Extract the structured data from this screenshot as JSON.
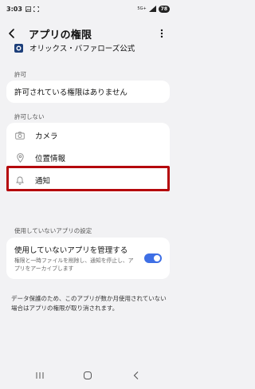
{
  "status": {
    "time": "3:03",
    "signal_label": "5G+",
    "battery": "78"
  },
  "header": {
    "title": "アプリの権限"
  },
  "app": {
    "name": "オリックス・バファローズ公式"
  },
  "allowed": {
    "label": "許可",
    "empty_text": "許可されている権限はありません"
  },
  "denied": {
    "label": "許可しない",
    "items": [
      {
        "label": "カメラ",
        "icon": "camera-icon"
      },
      {
        "label": "位置情報",
        "icon": "location-icon"
      },
      {
        "label": "通知",
        "icon": "bell-icon"
      }
    ]
  },
  "unused": {
    "label": "使用していないアプリの設定",
    "title": "使用していないアプリを管理する",
    "description": "権限と一時ファイルを削除し、通知を停止し、アプリをアーカイブします",
    "toggle_on": true
  },
  "footer_note": "データ保護のため、このアプリが数か月使用されていない場合はアプリの権限が取り消されます。",
  "colors": {
    "accent": "#3e6fe5",
    "highlight": "#b5080c",
    "background": "#f2f2f4"
  }
}
